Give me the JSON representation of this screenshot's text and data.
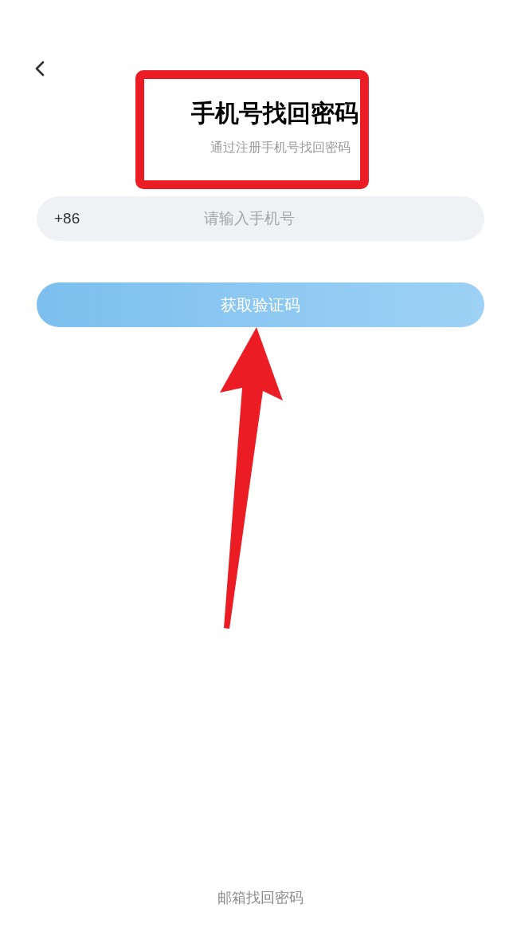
{
  "header": {
    "title": "手机号找回密码",
    "subtitle": "通过注册手机号找回密码"
  },
  "phone_field": {
    "country_code": "+86",
    "placeholder": "请输入手机号"
  },
  "submit_button": {
    "label": "获取验证码",
    "disabled": true
  },
  "footer_link": "邮箱找回密码"
}
